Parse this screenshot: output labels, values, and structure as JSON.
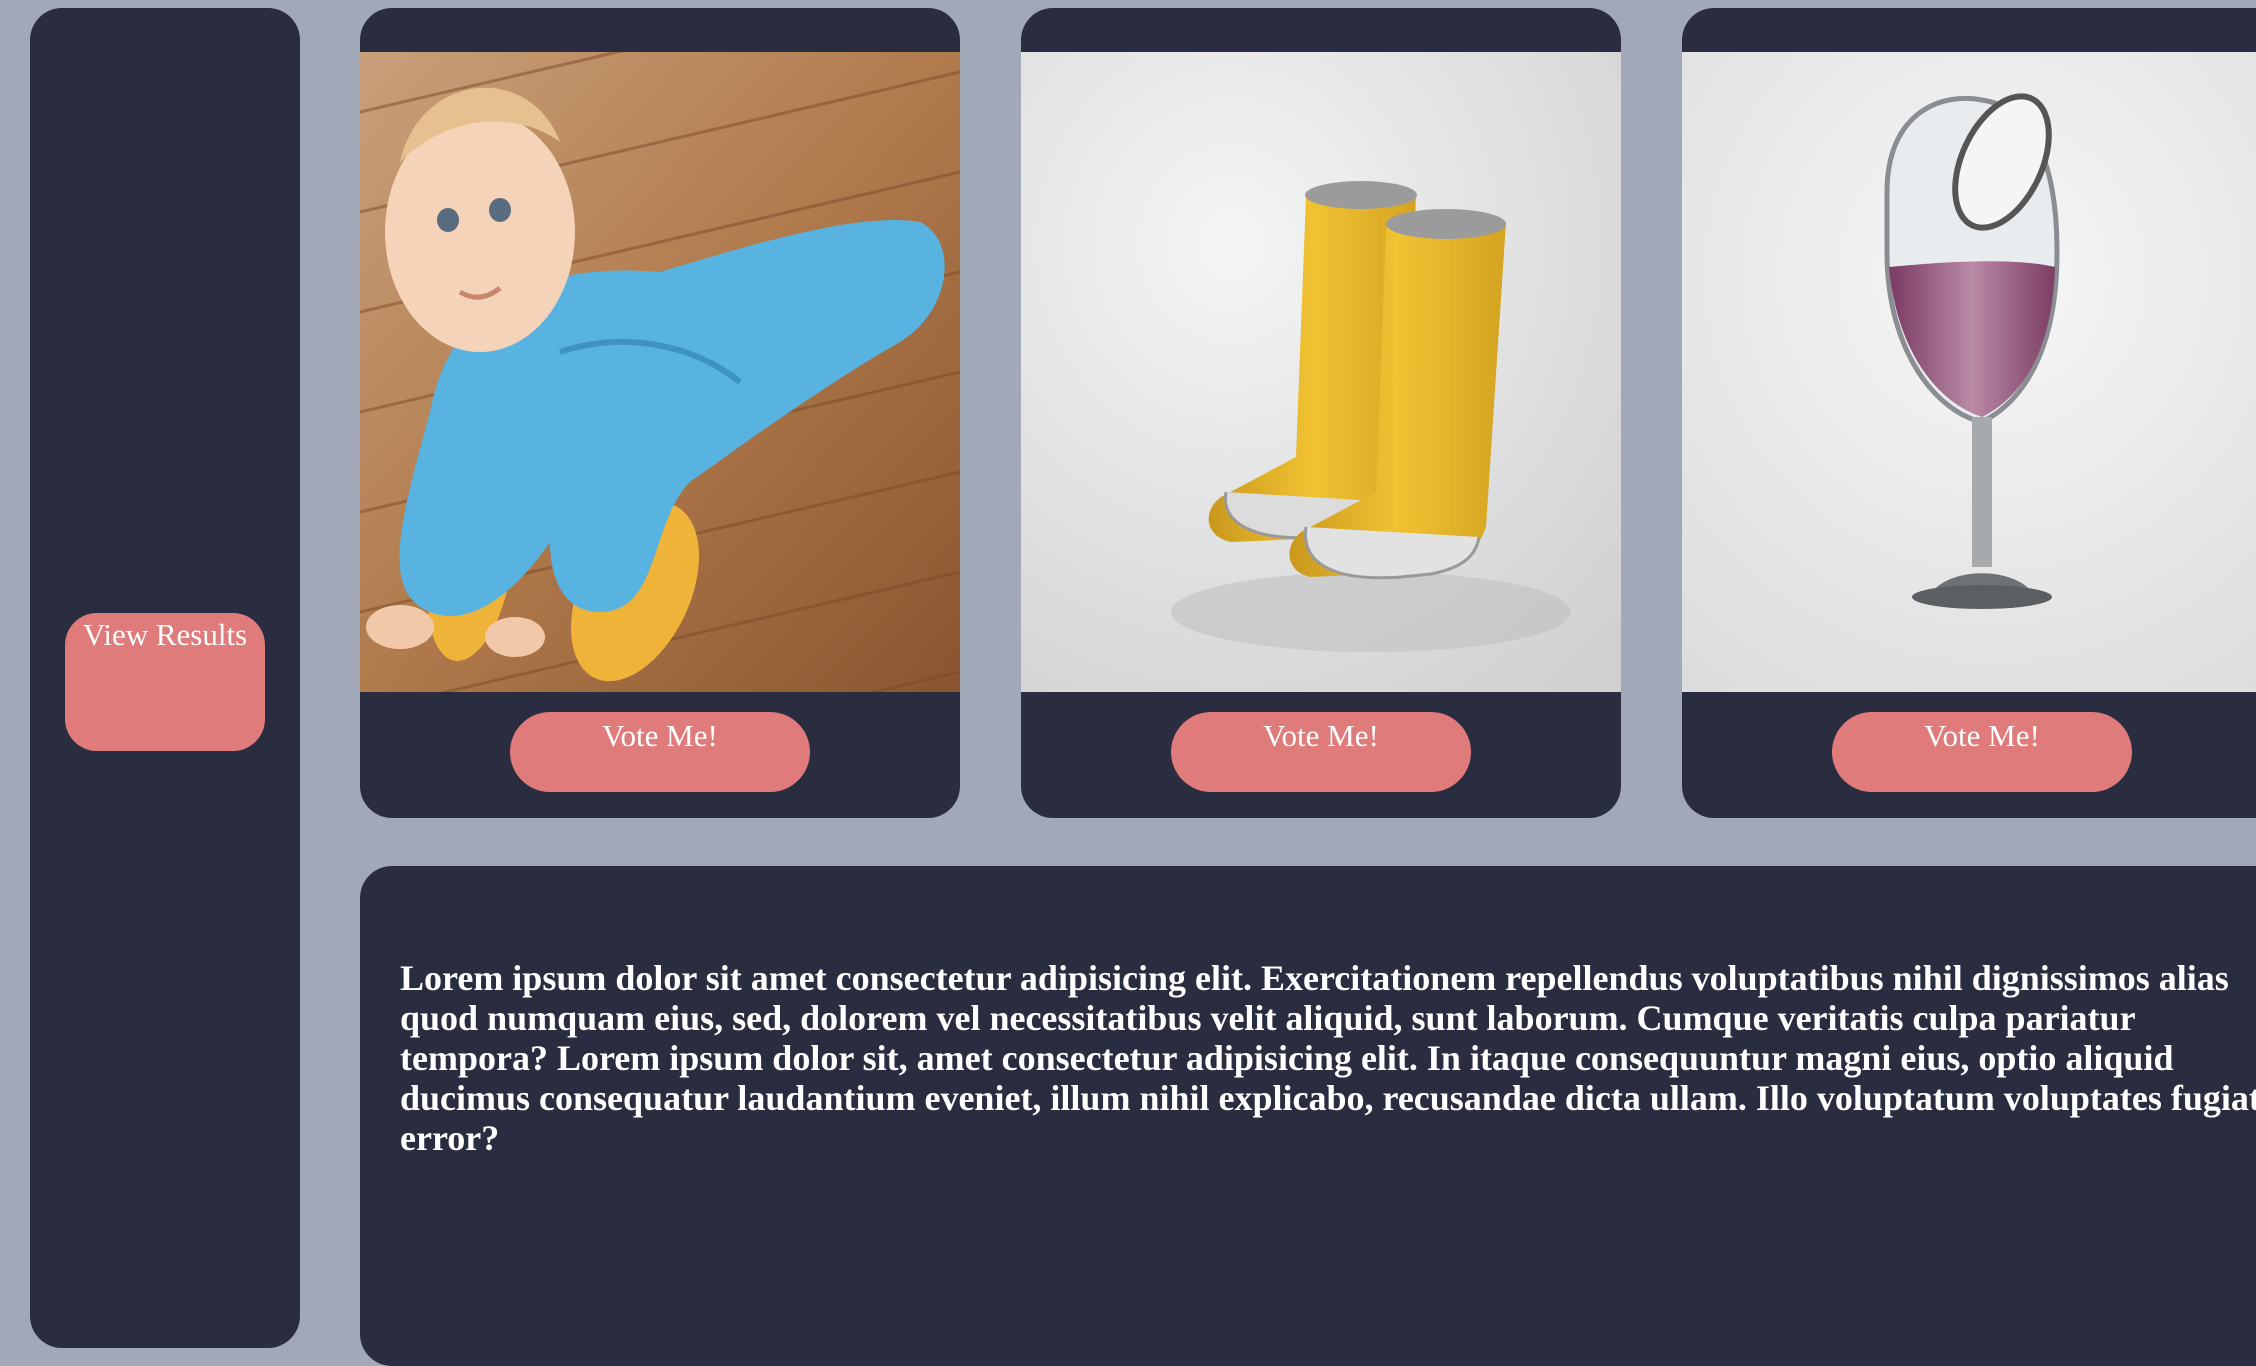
{
  "sidebar": {
    "results_label": "View Results"
  },
  "cards": [
    {
      "image": "baby-in-mop-onesie-photo",
      "vote_label": "Vote Me!"
    },
    {
      "image": "open-toe-yellow-rain-boots-photo",
      "vote_label": "Vote Me!"
    },
    {
      "image": "tipped-wine-glass-decanter-photo",
      "vote_label": "Vote Me!"
    }
  ],
  "description": {
    "text": "Lorem ipsum dolor sit amet consectetur adipisicing elit. Exercitationem repellendus voluptatibus nihil dignissimos alias quod numquam eius, sed, dolorem vel necessitatibus velit aliquid, sunt laborum. Cumque veritatis culpa pariatur tempora? Lorem ipsum dolor sit, amet consectetur adipisicing elit. In itaque consequuntur magni eius, optio aliquid ducimus consequatur laudantium eveniet, illum nihil explicabo, recusandae dicta ullam. Illo voluptatum voluptates fugiat error?"
  },
  "colors": {
    "page_background": "#a1a9b8",
    "panel": "#2a2d40",
    "button": "#e07b7b",
    "button_text": "#ffffff"
  }
}
